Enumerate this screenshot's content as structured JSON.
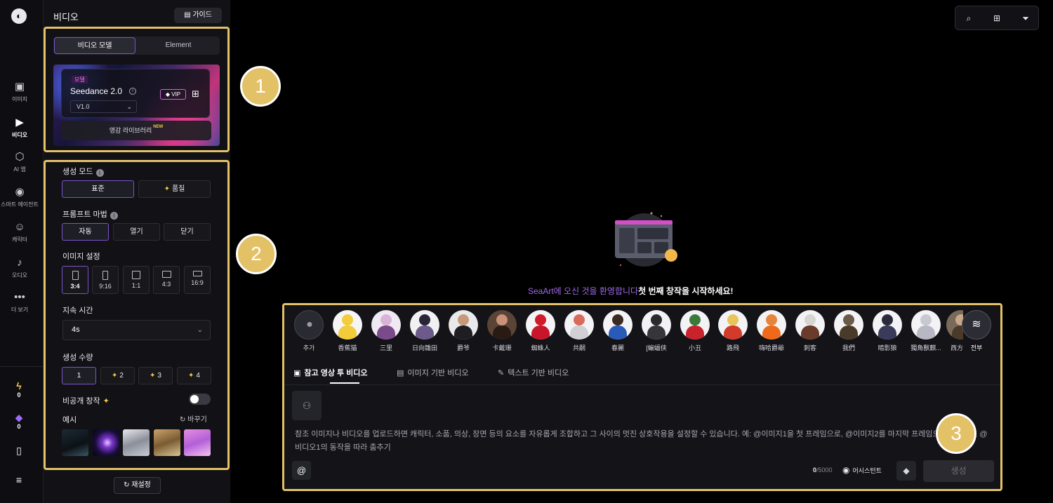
{
  "rail": {
    "items": [
      {
        "label": "이미지",
        "icon": "image-icon",
        "glyph": "▣"
      },
      {
        "label": "비디오",
        "icon": "video-icon",
        "glyph": "▶"
      },
      {
        "label": "AI 앱",
        "icon": "ai-app-icon",
        "glyph": "⬡"
      },
      {
        "label": "스마트 에이전트",
        "icon": "agent-icon",
        "glyph": "◉"
      },
      {
        "label": "캐릭터",
        "icon": "character-icon",
        "glyph": "☺"
      },
      {
        "label": "오디오",
        "icon": "audio-icon",
        "glyph": "♪"
      },
      {
        "label": "더 보기",
        "icon": "more-icon",
        "glyph": "•••"
      }
    ],
    "credits": [
      {
        "icon": "lightning-icon",
        "value": "0"
      },
      {
        "icon": "crystal-icon",
        "value": "0"
      }
    ]
  },
  "panel": {
    "title": "비디오",
    "guide_label": "가이드",
    "tabs": [
      "비디오 모델",
      "Element"
    ],
    "model": {
      "tag": "모델",
      "name": "Seedance 2.0",
      "vip": "VIP",
      "version": "V1.0",
      "inspiration": "영감 라이브러리",
      "new": "NEW"
    },
    "gen_mode": {
      "label": "생성 모드",
      "options": [
        "표준",
        "품질"
      ]
    },
    "prompt_magic": {
      "label": "프롬프트 마법",
      "options": [
        "자동",
        "열기",
        "닫기"
      ]
    },
    "image_settings": {
      "label": "이미지 설정",
      "ratios": [
        "3:4",
        "9:16",
        "1:1",
        "4:3",
        "16:9"
      ]
    },
    "duration": {
      "label": "지속 시간",
      "value": "4s"
    },
    "quantity": {
      "label": "생성 수량",
      "options": [
        "1",
        "2",
        "3",
        "4"
      ]
    },
    "private": {
      "label": "비공개 창작"
    },
    "examples": {
      "label": "예시",
      "swap": "바꾸기"
    },
    "reset": "재설정"
  },
  "main": {
    "welcome_purple": "SeaArt에 오신 것을 환영합니다",
    "welcome_white": "첫 번째 창작을 시작하세요!",
    "characters": [
      {
        "name": "추가"
      },
      {
        "name": "香蕉猫"
      },
      {
        "name": "三里"
      },
      {
        "name": "日向雛田"
      },
      {
        "name": "爵爷"
      },
      {
        "name": "卡戴珊"
      },
      {
        "name": "蜘蛛人"
      },
      {
        "name": "共嗣"
      },
      {
        "name": "春麗"
      },
      {
        "name": "[蝙蝠侠"
      },
      {
        "name": "小丑"
      },
      {
        "name": "路飛"
      },
      {
        "name": "嗨哈爵爺"
      },
      {
        "name": "刺客"
      },
      {
        "name": "我們"
      },
      {
        "name": "暗影狼"
      },
      {
        "name": "獨角獸麒..."
      },
      {
        "name": "西方"
      }
    ],
    "all_label": "전부",
    "mode_tabs": [
      "참고 영상 투 비디오",
      "이미지 기반 비디오",
      "텍스트 기반 비디오"
    ],
    "placeholder": "참조 이미지나 비디오를 업로드하면 캐릭터, 소품, 의상, 장면 등의 요소를 자유롭게 조합하고 그 사이의 멋진 상호작용을 설정할 수 있습니다. 예: @이미지1을 첫 프레임으로, @이미지2를 마지막 프레임으로 설정하고 @비디오1의 동작을 따라 춤추기",
    "at": "@",
    "count": "0",
    "count_max": "/5000",
    "assistant": "어시스턴트",
    "generate": "생성"
  },
  "annotations": [
    "1",
    "2",
    "3"
  ],
  "colors": {
    "accent": "#7b53c9",
    "highlight": "#e3c167",
    "welcome": "#a06ae8"
  }
}
